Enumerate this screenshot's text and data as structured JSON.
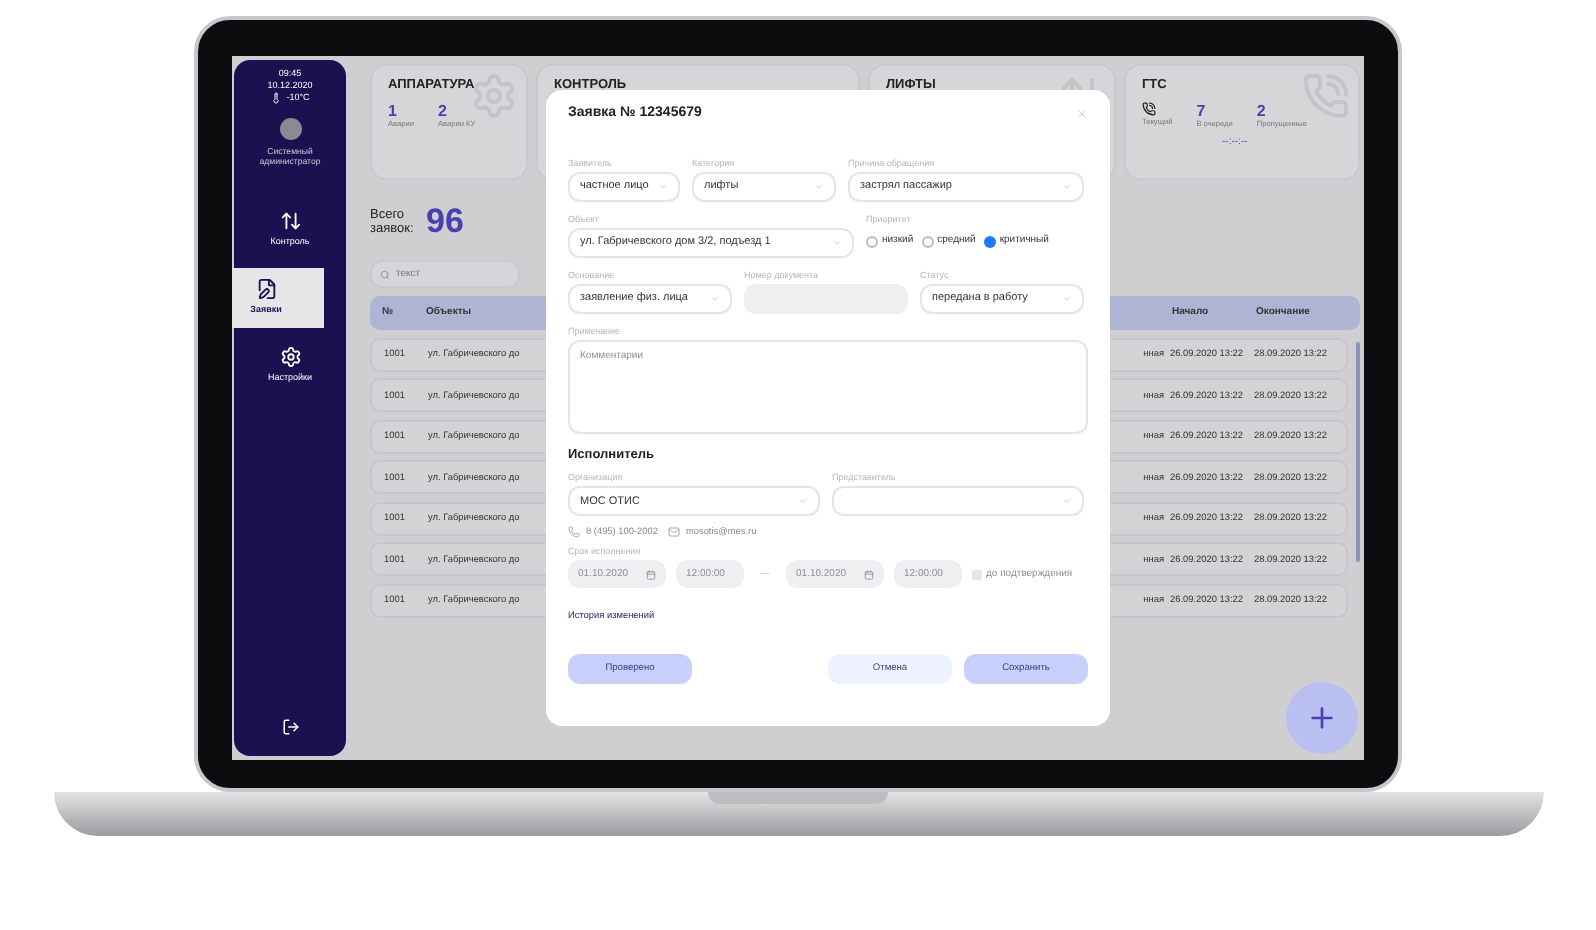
{
  "sidebar": {
    "time": "09:45",
    "date": "10.12.2020",
    "temperature": "-10°C",
    "user": "Системный администратор",
    "items": [
      {
        "label": "Контроль",
        "selected": false
      },
      {
        "label": "Заявки",
        "selected": true
      },
      {
        "label": "Настройки",
        "selected": false
      }
    ]
  },
  "cards": [
    {
      "title": "АППАРАТУРА",
      "stats": [
        {
          "value": "1",
          "label": "Аварии"
        },
        {
          "value": "2",
          "label": "Аварии КУ"
        }
      ]
    },
    {
      "title": "КОНТРОЛЬ"
    },
    {
      "title": "ЛИФТЫ"
    },
    {
      "title": "ГТС",
      "stats": [
        {
          "kind": "icon",
          "label": "Текущий"
        },
        {
          "kind": "number",
          "value": "7",
          "label": "В очереди"
        },
        {
          "kind": "number",
          "value": "2",
          "label": "Пропущенные"
        }
      ],
      "timer": "--:--:--"
    }
  ],
  "total": {
    "label": "Всего заявок:",
    "value": "96"
  },
  "search": {
    "placeholder": "текст"
  },
  "table": {
    "columns": [
      "№",
      "Объекты",
      "Начало",
      "Окончание"
    ],
    "rows": [
      {
        "number": "1001",
        "object": "ул. Габричевского до",
        "column_3": "нная",
        "start": "26.09.2020 13:22",
        "end": "28.09.2020 13:22"
      },
      {
        "number": "1001",
        "object": "ул. Габричевского до",
        "column_3": "нная",
        "start": "26.09.2020 13:22",
        "end": "28.09.2020 13:22"
      },
      {
        "number": "1001",
        "object": "ул. Габричевского до",
        "column_3": "нная",
        "start": "26.09.2020 13:22",
        "end": "28.09.2020 13:22"
      },
      {
        "number": "1001",
        "object": "ул. Габричевского до",
        "column_3": "нная",
        "start": "26.09.2020 13:22",
        "end": "28.09.2020 13:22"
      },
      {
        "number": "1001",
        "object": "ул. Габричевского до",
        "column_3": "нная",
        "start": "26.09.2020 13:22",
        "end": "28.09.2020 13:22"
      },
      {
        "number": "1001",
        "object": "ул. Габричевского до",
        "column_3": "нная",
        "start": "26.09.2020 13:22",
        "end": "28.09.2020 13:22"
      },
      {
        "number": "1001",
        "object": "ул. Габричевского до",
        "column_3": "нная",
        "start": "26.09.2020 13:22",
        "end": "28.09.2020 13:22"
      }
    ]
  },
  "modal": {
    "title": "Заявка № 12345679",
    "applicant": {
      "label": "Заявитель",
      "value": "частное лицо"
    },
    "category": {
      "label": "Категория",
      "value": "лифты"
    },
    "reason": {
      "label": "Причина обращения",
      "value": "застрял пассажир"
    },
    "object": {
      "label": "Объект",
      "value": "ул. Габричевского дом 3/2, подъезд 1"
    },
    "priority": {
      "label": "Приоритет",
      "options": [
        {
          "label": "низкий",
          "selected": false
        },
        {
          "label": "средний",
          "selected": false
        },
        {
          "label": "критичный",
          "selected": true
        }
      ]
    },
    "basis": {
      "label": "Основание",
      "value": "заявление физ. лица"
    },
    "document_number": {
      "label": "Номер документа"
    },
    "status": {
      "label": "Статус",
      "value": "передана в работу"
    },
    "note": {
      "label": "Примечание",
      "placeholder": "Комментарии"
    },
    "executor": {
      "heading": "Исполнитель",
      "organization": {
        "label": "Организация",
        "value": "МОС ОТИС"
      },
      "representative": {
        "label": "Представитель"
      },
      "phone": "8 (495) 100-2002",
      "email": "mosotis@mes.ru"
    },
    "deadline": {
      "label": "Срок исполнения",
      "start_date": "01.10.2020",
      "start_time": "12:00:00",
      "separator": "—",
      "end_date": "01.10.2020",
      "end_time": "12:00:00",
      "until_confirmed": {
        "label": "до подтверждения",
        "checked": false
      }
    },
    "history_link": "История изменений",
    "buttons": [
      {
        "label": "Проверено",
        "kind": "primary"
      },
      {
        "label": "Отмена",
        "kind": "secondary"
      },
      {
        "label": "Сохранить",
        "kind": "primary"
      }
    ]
  }
}
